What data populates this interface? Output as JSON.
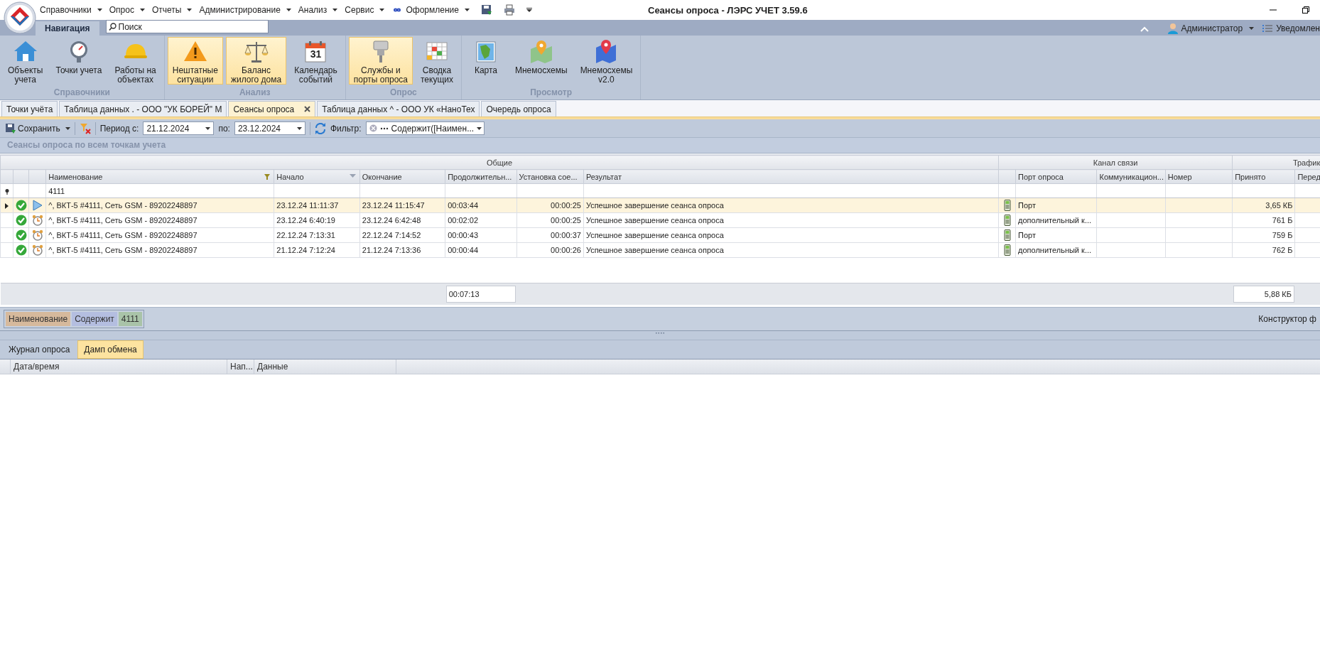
{
  "window": {
    "title": "Сеансы опроса - ЛЭРС УЧЕТ 3.59.6"
  },
  "menu": [
    {
      "label": "Справочники",
      "kind": "plain"
    },
    {
      "label": "Опрос",
      "kind": "plain"
    },
    {
      "label": "Отчеты",
      "kind": "plain"
    },
    {
      "label": "Администрирование",
      "kind": "plain"
    },
    {
      "label": "Анализ",
      "kind": "plain"
    },
    {
      "label": "Сервис",
      "kind": "plain"
    },
    {
      "label": "Оформление",
      "kind": "theme"
    }
  ],
  "ribbon": {
    "tabs": [
      {
        "label": "Навигация",
        "selected": true
      }
    ],
    "search": {
      "placeholder": "Поиск"
    },
    "user": "Администратор",
    "notifications": "Уведомлен",
    "groups": [
      {
        "label": "Справочники",
        "buttons": [
          {
            "label": "Объекты\nучета",
            "kind": "house",
            "selected": false
          },
          {
            "label": "Точки учета",
            "kind": "gauge",
            "selected": false
          },
          {
            "label": "Работы на\nобъектах",
            "kind": "helmet",
            "selected": false
          }
        ]
      },
      {
        "label": "Анализ",
        "buttons": [
          {
            "label": "Нештатные\nситуации",
            "kind": "warning",
            "selected": true
          },
          {
            "label": "Баланс\nжилого дома",
            "kind": "scales",
            "selected": true
          },
          {
            "label": "Календарь\nсобытий",
            "kind": "calendar",
            "icon_text": "31",
            "selected": false
          }
        ]
      },
      {
        "label": "Опрос",
        "buttons": [
          {
            "label": "Службы и\nпорты опроса",
            "kind": "connector",
            "selected": true
          },
          {
            "label": "Сводка\nтекущих",
            "kind": "grid",
            "selected": false
          }
        ]
      },
      {
        "label": "Просмотр",
        "buttons": [
          {
            "label": "Карта",
            "kind": "map",
            "selected": false
          },
          {
            "label": "Мнемосхемы",
            "kind": "pin",
            "selected": false
          },
          {
            "label": "Мнемосхемы\nv2.0",
            "kind": "pin2",
            "selected": false
          }
        ]
      }
    ]
  },
  "doc_tabs": [
    {
      "label": "Точки учёта",
      "selected": false
    },
    {
      "label": "Таблица данных . - ООО \"УК БОРЕЙ\"  М",
      "selected": false
    },
    {
      "label": "Сеансы опроса",
      "selected": true
    },
    {
      "label": "Таблица данных ^ - ООО УК «НаноТех",
      "selected": false
    },
    {
      "label": "Очередь опроса",
      "selected": false
    }
  ],
  "toolbar": {
    "save": "Сохранить",
    "period_label": "Период с:",
    "date_from": "21.12.2024",
    "to_label": "по:",
    "date_to": "23.12.2024",
    "filter_label": "Фильтр:",
    "filter_value": "Содержит([Наимен..."
  },
  "grid": {
    "caption": "Сеансы опроса по всем точкам учета",
    "bands": [
      {
        "label": "Общие",
        "columns": [
          {
            "label": "Наименование",
            "filtered": true,
            "sorted": false,
            "filter": "4111"
          },
          {
            "label": "Начало",
            "filtered": false,
            "sorted": true
          },
          {
            "label": "Окончание",
            "filtered": false,
            "sorted": false
          },
          {
            "label": "Продолжительн...",
            "filtered": false,
            "sorted": false,
            "total": "00:07:13"
          },
          {
            "label": "Установка сое...",
            "filtered": false,
            "sorted": false
          },
          {
            "label": "Результат",
            "filtered": false,
            "sorted": false
          }
        ]
      },
      {
        "label": "Канал связи",
        "columns": [
          {
            "label": "Порт опроса",
            "filtered": false,
            "sorted": false
          },
          {
            "label": "Коммуникацион...",
            "filtered": false,
            "sorted": false
          },
          {
            "label": "Номер",
            "filtered": false,
            "sorted": false
          }
        ]
      },
      {
        "label": "Трафик",
        "columns": [
          {
            "label": "Принято",
            "filtered": false,
            "sorted": false,
            "total": "5,88 КБ"
          },
          {
            "label": "Перед"
          }
        ]
      }
    ],
    "rows": [
      {
        "selected": true,
        "scheduled": false,
        "name": "^, ВКТ-5 #4111, Сеть GSM - 89202248897",
        "start": "23.12.24 11:11:37",
        "end": "23.12.24 11:15:47",
        "duration": "00:03:44",
        "setup": "00:00:25",
        "result": "Успешное завершение сеанса опроса",
        "port": "Порт",
        "received": "3,65 КБ"
      },
      {
        "selected": false,
        "scheduled": true,
        "name": "^, ВКТ-5 #4111, Сеть GSM - 89202248897",
        "start": "23.12.24 6:40:19",
        "end": "23.12.24 6:42:48",
        "duration": "00:02:02",
        "setup": "00:00:25",
        "result": "Успешное завершение сеанса опроса",
        "port": "дополнительный к...",
        "received": "761 Б"
      },
      {
        "selected": false,
        "scheduled": true,
        "name": "^, ВКТ-5 #4111, Сеть GSM - 89202248897",
        "start": "22.12.24 7:13:31",
        "end": "22.12.24 7:14:52",
        "duration": "00:00:43",
        "setup": "00:00:37",
        "result": "Успешное завершение сеанса опроса",
        "port": "Порт",
        "received": "759 Б"
      },
      {
        "selected": false,
        "scheduled": true,
        "name": "^, ВКТ-5 #4111, Сеть GSM - 89202248897",
        "start": "21.12.24 7:12:24",
        "end": "21.12.24 7:13:36",
        "duration": "00:00:44",
        "setup": "00:00:26",
        "result": "Успешное завершение сеанса опроса",
        "port": "дополнительный к...",
        "received": "762 Б"
      }
    ],
    "filter_tokens": [
      {
        "text": "Наименование",
        "color": "#d6b99c"
      },
      {
        "text": "Содержит",
        "color": "#b4bee0"
      },
      {
        "text": "4111",
        "color": "#a9c3a8"
      }
    ],
    "filter_builder": "Конструктор ф"
  },
  "bottom": {
    "tabs": [
      {
        "label": "Журнал опроса",
        "selected": false
      },
      {
        "label": "Дамп обмена",
        "selected": true
      }
    ],
    "columns": [
      "Дата/время",
      "Нап...",
      "Данные"
    ]
  }
}
